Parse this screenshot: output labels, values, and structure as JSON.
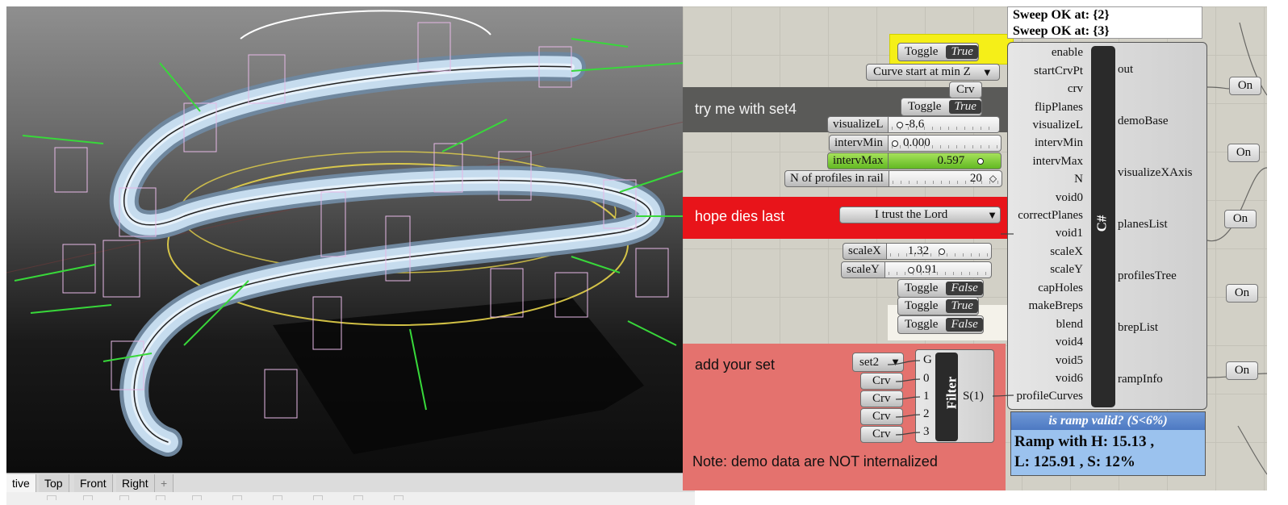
{
  "viewport": {
    "tabs": [
      "tive",
      "Top",
      "Front",
      "Right",
      "+"
    ],
    "active_tab": "tive"
  },
  "groups": {
    "set4": "try me with set4",
    "hope": "hope dies last",
    "add": "add your set",
    "note": "Note: demo data are NOT internalized"
  },
  "params": {
    "toggle1": {
      "label": "Toggle",
      "value": "True"
    },
    "curve_start": {
      "label": "Curve start at min Z"
    },
    "crv": {
      "label": "Crv"
    },
    "toggle2": {
      "label": "Toggle",
      "value": "True"
    },
    "trust": {
      "label": "I trust the Lord"
    },
    "toggle_cap": {
      "label": "Toggle",
      "value": "False"
    },
    "toggle_breps": {
      "label": "Toggle",
      "value": "True"
    },
    "toggle_blend": {
      "label": "Toggle",
      "value": "False"
    },
    "set2": {
      "label": "set2"
    },
    "crv_list": [
      "Crv",
      "Crv",
      "Crv",
      "Crv"
    ]
  },
  "sliders": {
    "visualizeL": {
      "name": "visualizeL",
      "value": "-8.6",
      "fraction": 0.06
    },
    "intervMin": {
      "name": "intervMin",
      "value": "0.000",
      "fraction": 0.0
    },
    "intervMax": {
      "name": "intervMax",
      "value": "0.597",
      "fraction": 0.6
    },
    "nprofiles": {
      "name": "N of profiles in rail",
      "value": "20",
      "fraction": 1.0
    },
    "scaleX": {
      "name": "scaleX",
      "value": "1.32",
      "fraction": 0.6
    },
    "scaleY": {
      "name": "scaleY",
      "value": "0.91",
      "fraction": 0.2
    }
  },
  "csharp": {
    "title": "C#",
    "inputs": [
      "enable",
      "startCrvPt",
      "crv",
      "flipPlanes",
      "visualizeL",
      "intervMin",
      "intervMax",
      "N",
      "void0",
      "correctPlanes",
      "void1",
      "scaleX",
      "scaleY",
      "capHoles",
      "makeBreps",
      "blend",
      "void4",
      "void5",
      "void6",
      "profileCurves"
    ],
    "outputs": [
      "out",
      "demoBase",
      "visualizeXAxis",
      "planesList",
      "profilesTree",
      "brepList",
      "rampInfo"
    ]
  },
  "filter": {
    "title": "Filter",
    "inputs": [
      "G",
      "0",
      "1",
      "2",
      "3"
    ],
    "output": "S(1)"
  },
  "panel_top": {
    "lines": [
      "Sweep OK at: {2}",
      "Sweep OK at: {3}"
    ]
  },
  "panel_ramp": {
    "header": "is ramp valid? (S<6%)",
    "line1": "Ramp with H: 15.13 ,",
    "line2": "L: 125.91 , S: 12%"
  },
  "on_buttons": [
    "On",
    "On",
    "On",
    "On",
    "On"
  ]
}
